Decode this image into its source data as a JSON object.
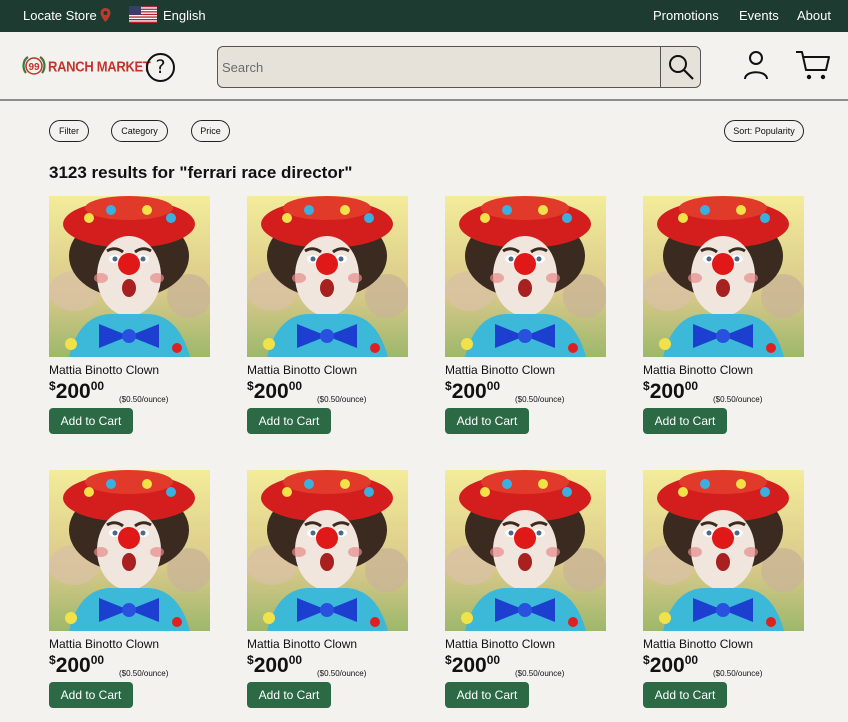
{
  "topbar": {
    "locate_store": "Locate Store",
    "language": "English",
    "nav": [
      "Promotions",
      "Events",
      "About"
    ]
  },
  "header": {
    "logo_number": "99",
    "logo_text": "RANCH MARKET",
    "search_placeholder": "Search"
  },
  "filters": {
    "filter": "Filter",
    "category": "Category",
    "price": "Price",
    "sort": "Sort: Popularity"
  },
  "results": {
    "heading": "3123 results for \"ferrari race director\""
  },
  "colors": {
    "topbar_bg": "#1d3b30",
    "button_green": "#2c6a46",
    "brand_red": "#c2332b"
  },
  "products": [
    {
      "name": "Mattia Binotto Clown",
      "currency": "$",
      "price_whole": "200",
      "price_cents": "00",
      "unit_price": "($0.50/ounce)",
      "button": "Add to Cart"
    },
    {
      "name": "Mattia Binotto Clown",
      "currency": "$",
      "price_whole": "200",
      "price_cents": "00",
      "unit_price": "($0.50/ounce)",
      "button": "Add to Cart"
    },
    {
      "name": "Mattia Binotto Clown",
      "currency": "$",
      "price_whole": "200",
      "price_cents": "00",
      "unit_price": "($0.50/ounce)",
      "button": "Add to Cart"
    },
    {
      "name": "Mattia Binotto Clown",
      "currency": "$",
      "price_whole": "200",
      "price_cents": "00",
      "unit_price": "($0.50/ounce)",
      "button": "Add to Cart"
    },
    {
      "name": "Mattia Binotto Clown",
      "currency": "$",
      "price_whole": "200",
      "price_cents": "00",
      "unit_price": "($0.50/ounce)",
      "button": "Add to Cart"
    },
    {
      "name": "Mattia Binotto Clown",
      "currency": "$",
      "price_whole": "200",
      "price_cents": "00",
      "unit_price": "($0.50/ounce)",
      "button": "Add to Cart"
    },
    {
      "name": "Mattia Binotto Clown",
      "currency": "$",
      "price_whole": "200",
      "price_cents": "00",
      "unit_price": "($0.50/ounce)",
      "button": "Add to Cart"
    },
    {
      "name": "Mattia Binotto Clown",
      "currency": "$",
      "price_whole": "200",
      "price_cents": "00",
      "unit_price": "($0.50/ounce)",
      "button": "Add to Cart"
    }
  ]
}
